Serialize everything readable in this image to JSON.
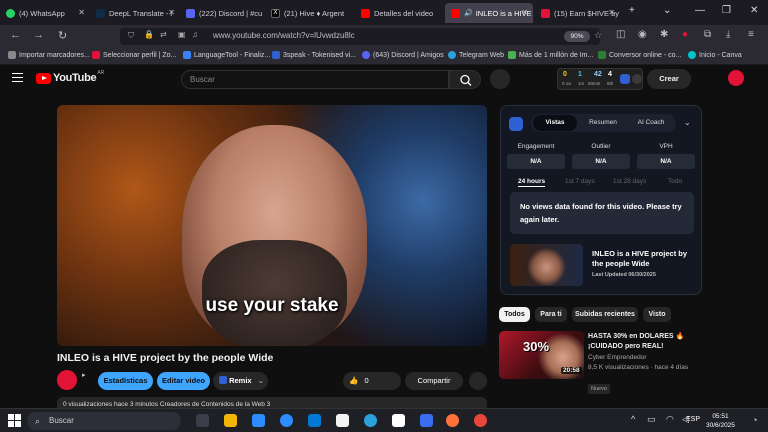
{
  "browser": {
    "tabs": [
      {
        "label": "(4) WhatsApp",
        "color": "#25d366"
      },
      {
        "label": "DeepL Translate - l",
        "color": "#0f2b46"
      },
      {
        "label": "(222) Discord | #cu",
        "color": "#5865f2"
      },
      {
        "label": "(21) Hive ♦ Argent",
        "color": "#111111"
      },
      {
        "label": "Detalles del video",
        "color": "#ff0000"
      },
      {
        "label": "INLEO is a HIVE",
        "color": "#ff0000"
      },
      {
        "label": "(15) Earn $HIVE by",
        "color": "#e31337"
      }
    ],
    "new_tab": "+",
    "dropdown": "⌄",
    "minimize": "—",
    "restore": "❐",
    "close": "✕",
    "url": "www.youtube.com/watch?v=lUvwdzu8lc",
    "zoom": "90%",
    "bookmarks": [
      {
        "label": "Importar marcadores...",
        "color": "#888888"
      },
      {
        "label": "Seleccionar perfil | Zo...",
        "color": "#e31337"
      },
      {
        "label": "LanguageTool - Finaliz...",
        "color": "#3b82f6"
      },
      {
        "label": "3speak - Tokenised vi...",
        "color": "#2f5fd0"
      },
      {
        "label": "(643) Discord | Amigos",
        "color": "#5865f2"
      },
      {
        "label": "Telegram Web",
        "color": "#2aa1da"
      },
      {
        "label": "Más de 1 millón de Im...",
        "color": "#4caf50"
      },
      {
        "label": "Conversor online - co...",
        "color": "#2e7d32"
      },
      {
        "label": "Inicio - Canva",
        "color": "#00c4cc"
      }
    ]
  },
  "youtube": {
    "logo_text": "YouTube",
    "country": "AR",
    "search_placeholder": "Buscar",
    "create_label": "Crear",
    "stats": {
      "a": "0",
      "a_sub": "0 1a",
      "b": "1",
      "b_sub": "1m",
      "c": "42",
      "c_sub": "60min",
      "d": "4",
      "d_sub": "6th"
    },
    "video": {
      "subtitle": "use your stake",
      "title": "INLEO is a HIVE project by the people Wide",
      "buttons": {
        "stats": "Estadísticas",
        "edit": "Editar video",
        "remix": "Remix",
        "like_count": "0",
        "share": "Compartir"
      },
      "description": "0 visualizaciones  hace 3 minutos  Creadores de Contenidos de la Web 3"
    },
    "chips": [
      "Todos",
      "Para ti",
      "Subidas recientes",
      "Visto"
    ],
    "recommendation": {
      "title": "HASTA 30% en DOLARES 🔥 ¡CUIDADO pero REAL!",
      "channel": "Cyber Emprendedor",
      "meta": "8,5 K visualizaciones · hace 4 días",
      "badge": "Nuevo",
      "duration": "20:58",
      "thumb_text": "30%"
    }
  },
  "inleo_panel": {
    "tabs": [
      "Vistas",
      "Resumen",
      "AI Coach"
    ],
    "kpis": [
      {
        "label": "Engagement",
        "value": "N/A"
      },
      {
        "label": "Outlier",
        "value": "N/A"
      },
      {
        "label": "VPH",
        "value": "N/A"
      }
    ],
    "periods": [
      "24 hours",
      "1st 7 days",
      "1st 28 days",
      "Todo"
    ],
    "no_data": "No views data found for this video. Please try again later.",
    "preview_title": "INLEO is a HIVE project by the people Wide",
    "last_updated": "Last Updated 06/30/2025"
  },
  "taskbar": {
    "search": "Buscar",
    "lang": "ESP",
    "time": "05:51",
    "date": "30/6/2025"
  }
}
